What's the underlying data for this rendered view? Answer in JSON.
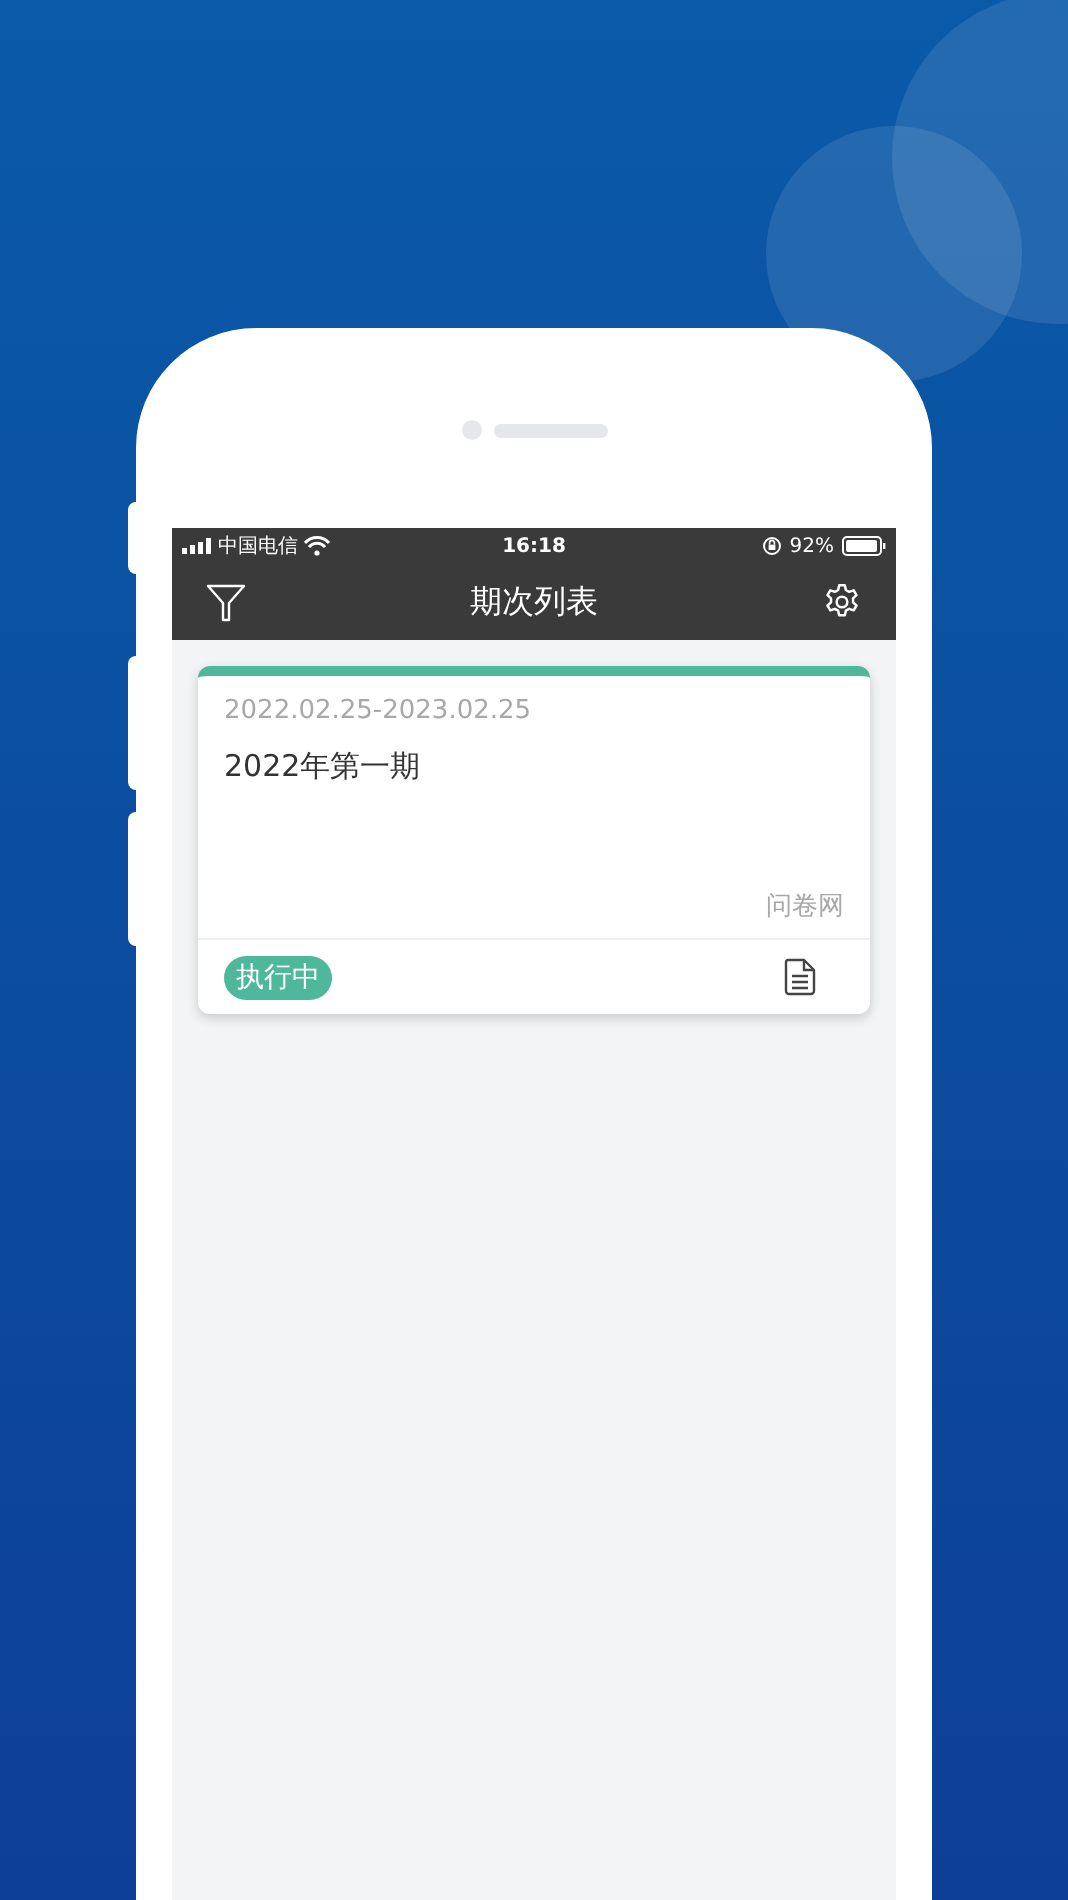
{
  "status_bar": {
    "carrier": "中国电信",
    "time": "16:18",
    "battery": "92%"
  },
  "nav_bar": {
    "title": "期次列表"
  },
  "cards": [
    {
      "date_range": "2022.02.25-2023.02.25",
      "title": "2022年第一期",
      "source": "问卷网",
      "status": {
        "label": "执行中",
        "kind": "active"
      }
    }
  ]
}
